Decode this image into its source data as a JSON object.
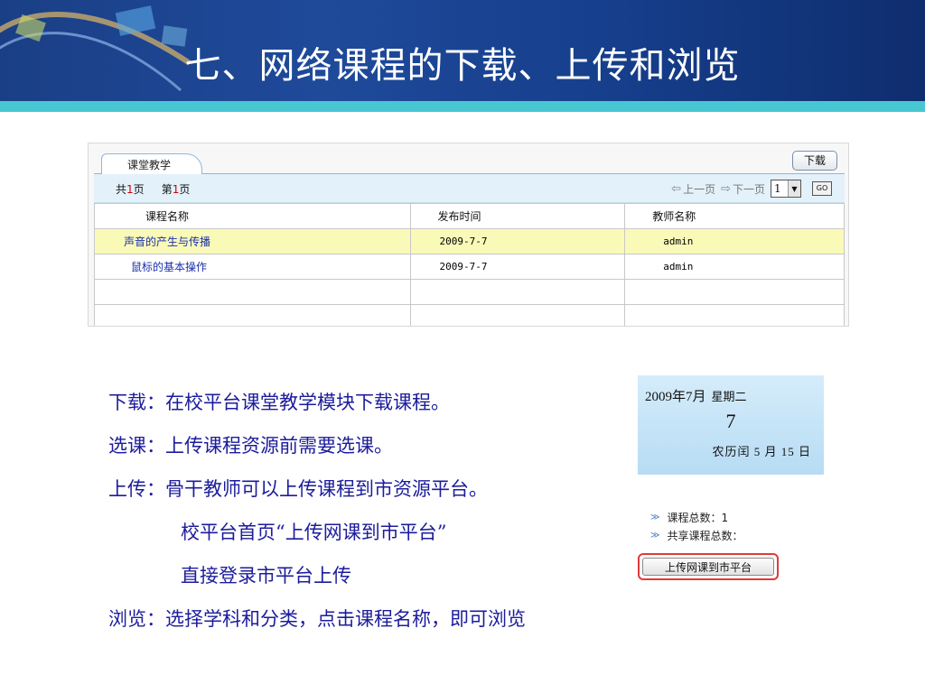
{
  "banner": {
    "title": "七、网络课程的下载、上传和浏览"
  },
  "panel": {
    "tab_label": "课堂教学",
    "download_button": "下载",
    "pager": {
      "total_prefix": "共",
      "total_pages": "1",
      "total_suffix": "页",
      "current_prefix": "第",
      "current_page": "1",
      "current_suffix": "页",
      "prev_label": "上一页",
      "next_label": "下一页",
      "page_select_value": "1",
      "go_label": "GO"
    },
    "table": {
      "headers": [
        "课程名称",
        "发布时间",
        "教师名称"
      ],
      "rows": [
        {
          "name": "声音的产生与传播",
          "date": "2009-7-7",
          "teacher": "admin"
        },
        {
          "name": "鼠标的基本操作",
          "date": "2009-7-7",
          "teacher": "admin"
        }
      ]
    }
  },
  "notes": [
    "下载：在校平台课堂教学模块下载课程。",
    "选课：上传课程资源前需要选课。",
    "上传：骨干教师可以上传课程到市资源平台。",
    "校平台首页“上传网课到市平台”",
    "直接登录市平台上传",
    "浏览：选择学科和分类，点击课程名称，即可浏览"
  ],
  "calendar": {
    "year_month": "2009年7月",
    "weekday": "星期二",
    "day": "7",
    "lunar": "农历闰 5 月 15 日"
  },
  "stats": {
    "course_total": "课程总数：1",
    "shared_total": "共享课程总数："
  },
  "upload_button": "上传网课到市平台",
  "colors": {
    "banner_blue": "#1f4a9a",
    "banner_strip": "#47c7d2",
    "notes_text": "#1c1c9c",
    "highlight_row": "#fafab8",
    "upload_outline": "#e03a3a"
  }
}
